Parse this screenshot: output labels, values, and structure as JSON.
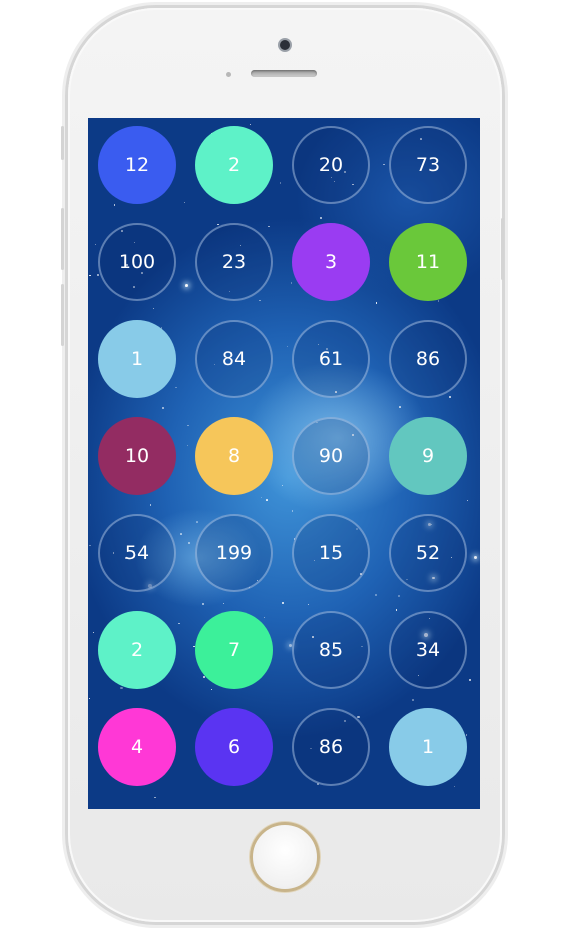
{
  "board": {
    "rows": [
      [
        {
          "value": "12",
          "color": "#3a5cf0"
        },
        {
          "value": "2",
          "color": "#5ef2c8"
        },
        {
          "value": "20",
          "color": null
        },
        {
          "value": "73",
          "color": null
        }
      ],
      [
        {
          "value": "100",
          "color": null
        },
        {
          "value": "23",
          "color": null
        },
        {
          "value": "3",
          "color": "#9a3cf2"
        },
        {
          "value": "11",
          "color": "#6ac83a"
        }
      ],
      [
        {
          "value": "1",
          "color": "#88cbe8"
        },
        {
          "value": "84",
          "color": null
        },
        {
          "value": "61",
          "color": null
        },
        {
          "value": "86",
          "color": null
        }
      ],
      [
        {
          "value": "10",
          "color": "#932c62"
        },
        {
          "value": "8",
          "color": "#f6c65a"
        },
        {
          "value": "90",
          "color": null
        },
        {
          "value": "9",
          "color": "#62c7bf"
        }
      ],
      [
        {
          "value": "54",
          "color": null
        },
        {
          "value": "199",
          "color": null
        },
        {
          "value": "15",
          "color": null
        },
        {
          "value": "52",
          "color": null
        }
      ],
      [
        {
          "value": "2",
          "color": "#5ef2c8"
        },
        {
          "value": "7",
          "color": "#3cf09a"
        },
        {
          "value": "85",
          "color": null
        },
        {
          "value": "34",
          "color": null
        }
      ],
      [
        {
          "value": "4",
          "color": "#ff38d6"
        },
        {
          "value": "6",
          "color": "#5a34f2"
        },
        {
          "value": "86",
          "color": null
        },
        {
          "value": "1",
          "color": "#88cbe8"
        }
      ]
    ]
  }
}
